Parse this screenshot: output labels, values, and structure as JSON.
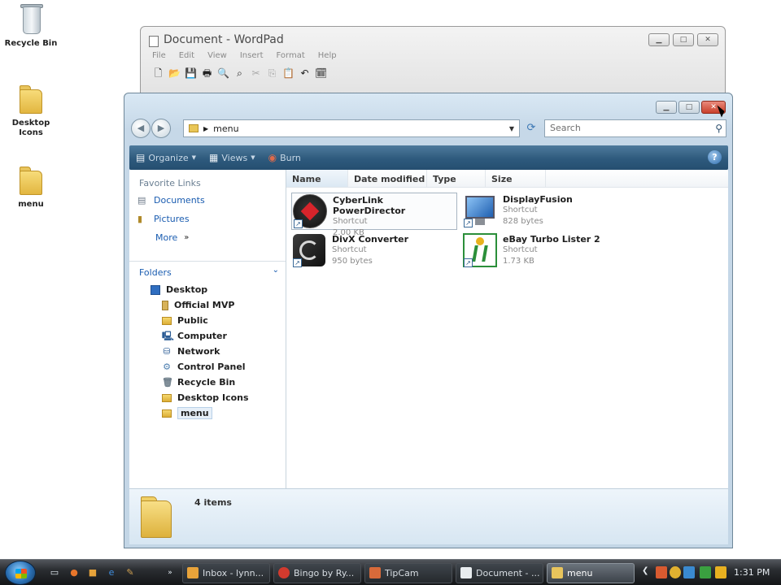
{
  "desktop": {
    "icons": [
      {
        "label": "Recycle Bin"
      },
      {
        "label": "Desktop Icons"
      },
      {
        "label": "menu"
      }
    ]
  },
  "wordpad": {
    "title": "Document - WordPad",
    "menu": [
      "File",
      "Edit",
      "View",
      "Insert",
      "Format",
      "Help"
    ],
    "toolbar_icons": [
      "new-icon",
      "open-icon",
      "save-icon",
      "print-icon",
      "print-preview-icon",
      "find-icon",
      "cut-icon",
      "copy-icon",
      "paste-icon",
      "undo-icon",
      "date-time-icon"
    ]
  },
  "explorer": {
    "address": {
      "path": "menu"
    },
    "search": {
      "placeholder": "Search"
    },
    "command_bar": {
      "organize": "Organize",
      "views": "Views",
      "burn": "Burn"
    },
    "favorite_links": {
      "header": "Favorite Links",
      "items": [
        "Documents",
        "Pictures"
      ],
      "more": "More"
    },
    "folders": {
      "header": "Folders",
      "tree": [
        {
          "label": "Desktop",
          "level": 0
        },
        {
          "label": "Official MVP",
          "level": 1
        },
        {
          "label": "Public",
          "level": 1
        },
        {
          "label": "Computer",
          "level": 1
        },
        {
          "label": "Network",
          "level": 1
        },
        {
          "label": "Control Panel",
          "level": 1
        },
        {
          "label": "Recycle Bin",
          "level": 1
        },
        {
          "label": "Desktop Icons",
          "level": 1
        },
        {
          "label": "menu",
          "level": 1,
          "selected": true
        }
      ]
    },
    "columns": [
      "Name",
      "Date modified",
      "Type",
      "Size"
    ],
    "files": [
      {
        "name": "CyberLink PowerDirector",
        "type": "Shortcut",
        "size": "2.00 KB"
      },
      {
        "name": "DisplayFusion",
        "type": "Shortcut",
        "size": "828 bytes"
      },
      {
        "name": "DivX Converter",
        "type": "Shortcut",
        "size": "950 bytes"
      },
      {
        "name": "eBay Turbo Lister 2",
        "type": "Shortcut",
        "size": "1.73 KB"
      }
    ],
    "details": {
      "count": "4 items"
    }
  },
  "taskbar": {
    "buttons": [
      {
        "label": "Inbox - lynn..."
      },
      {
        "label": "Bingo by Ry..."
      },
      {
        "label": "TipCam"
      },
      {
        "label": "Document - ..."
      },
      {
        "label": "menu"
      }
    ],
    "clock": "1:31 PM"
  }
}
